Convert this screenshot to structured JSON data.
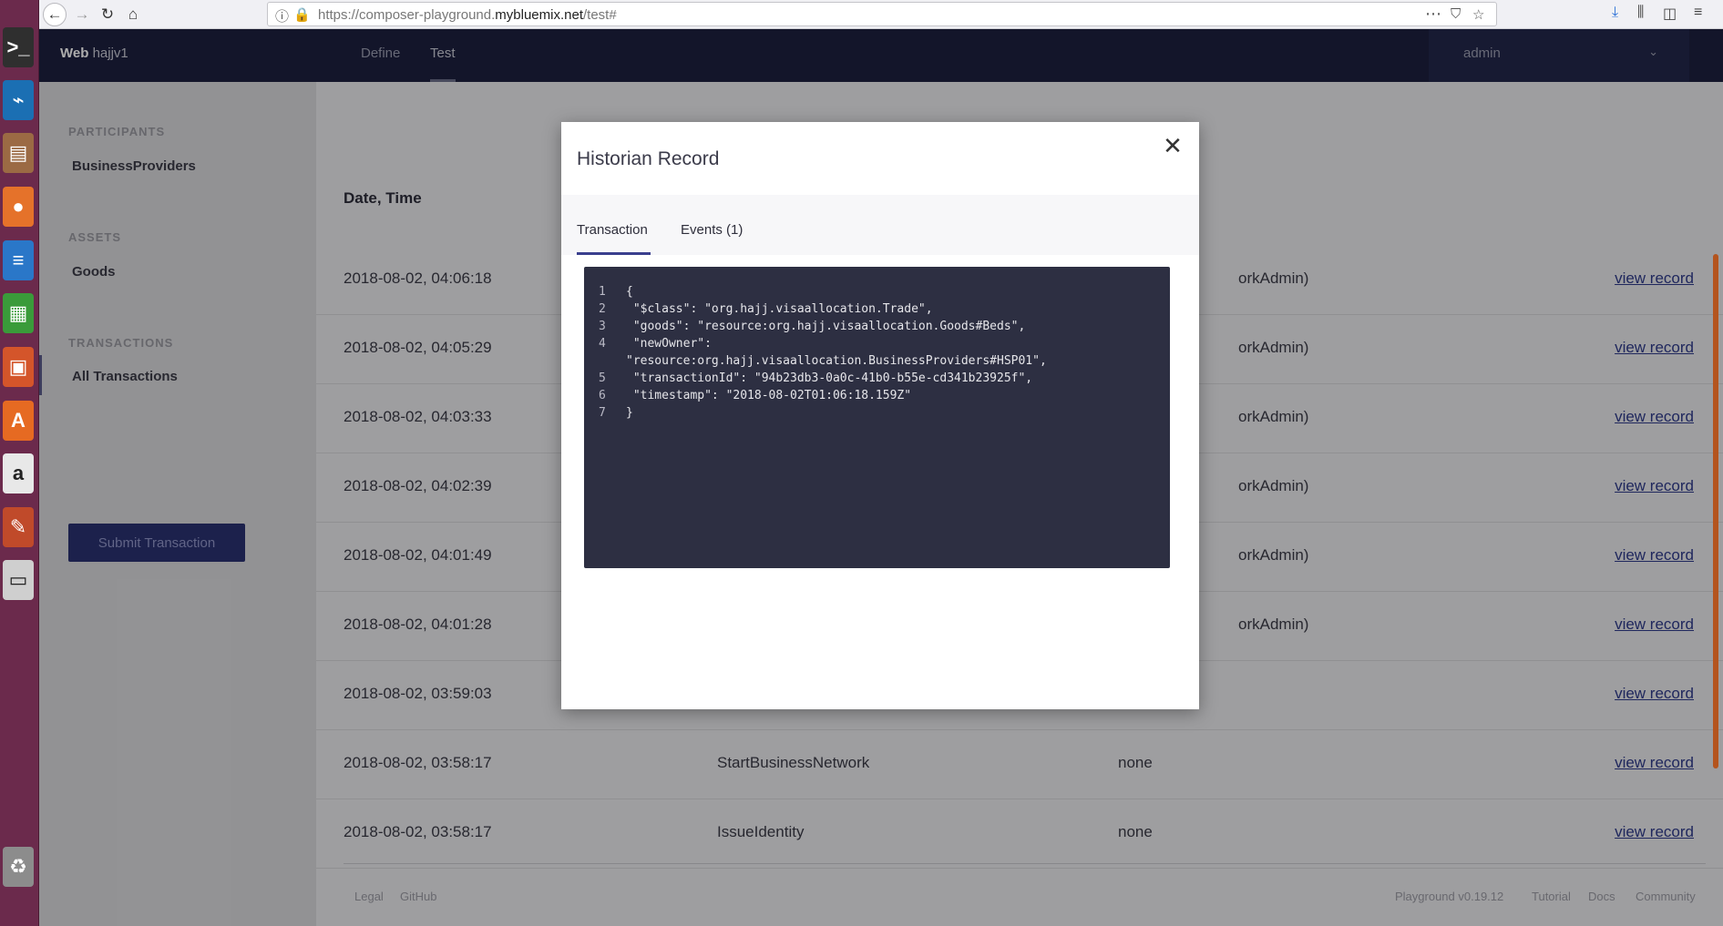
{
  "launcher": {
    "apps": [
      {
        "icon": "terminal-icon",
        "glyph": ">_",
        "bg": "#2f2f2f"
      },
      {
        "icon": "vscode-icon",
        "glyph": "⌁",
        "bg": "#1b6fb3"
      },
      {
        "icon": "files-icon",
        "glyph": "▤",
        "bg": "#9b6a44"
      },
      {
        "icon": "firefox-icon",
        "glyph": "●",
        "bg": "#e5722a"
      },
      {
        "icon": "writer-icon",
        "glyph": "≡",
        "bg": "#2a77c8"
      },
      {
        "icon": "calc-icon",
        "glyph": "▦",
        "bg": "#3a9b3a"
      },
      {
        "icon": "impress-icon",
        "glyph": "▣",
        "bg": "#d4552a"
      },
      {
        "icon": "software-center-icon",
        "glyph": "A",
        "bg": "#e66a22"
      },
      {
        "icon": "amazon-icon",
        "glyph": "a",
        "bg": "#e8e8e8"
      },
      {
        "icon": "settings-icon",
        "glyph": "✎",
        "bg": "#c04a2a"
      },
      {
        "icon": "drive-icon",
        "glyph": "▭",
        "bg": "#cfcfcf"
      },
      {
        "icon": "trash-icon",
        "glyph": "♻",
        "bg": "#8c8c8c"
      }
    ]
  },
  "browser": {
    "url_prefix": "https://composer-playground.",
    "url_domain": "mybluemix.net",
    "url_suffix": "/test#"
  },
  "topnav": {
    "brand_strong": "Web",
    "brand_name": "hajjv1",
    "tabs": [
      "Define",
      "Test"
    ],
    "user": "admin"
  },
  "sidebar": {
    "participants_heading": "PARTICIPANTS",
    "participant_item": "BusinessProviders",
    "assets_heading": "ASSETS",
    "asset_item": "Goods",
    "transactions_heading": "TRANSACTIONS",
    "transaction_item": "All Transactions",
    "submit_label": "Submit Transaction"
  },
  "table": {
    "col_date": "Date, Time",
    "view_label": "view record",
    "rows": [
      {
        "date": "2018-08-02, 04:06:18",
        "type": "",
        "participant": "orkAdmin)"
      },
      {
        "date": "2018-08-02, 04:05:29",
        "type": "",
        "participant": "orkAdmin)"
      },
      {
        "date": "2018-08-02, 04:03:33",
        "type": "",
        "participant": "orkAdmin)"
      },
      {
        "date": "2018-08-02, 04:02:39",
        "type": "",
        "participant": "orkAdmin)"
      },
      {
        "date": "2018-08-02, 04:01:49",
        "type": "",
        "participant": "orkAdmin)"
      },
      {
        "date": "2018-08-02, 04:01:28",
        "type": "",
        "participant": "orkAdmin)"
      },
      {
        "date": "2018-08-02, 03:59:03",
        "type": "",
        "participant": ""
      },
      {
        "date": "2018-08-02, 03:58:17",
        "type": "StartBusinessNetwork",
        "participant": "none"
      },
      {
        "date": "2018-08-02, 03:58:17",
        "type": "IssueIdentity",
        "participant": "none"
      }
    ]
  },
  "footer": {
    "legal": "Legal",
    "github": "GitHub",
    "version": "Playground v0.19.12",
    "tutorial": "Tutorial",
    "docs": "Docs",
    "community": "Community"
  },
  "modal": {
    "title": "Historian Record",
    "tab_transaction": "Transaction",
    "tab_events": "Events (1)",
    "code": [
      {
        "n": "1",
        "text": "{"
      },
      {
        "n": "2",
        "text": " \"$class\": \"org.hajj.visaallocation.Trade\","
      },
      {
        "n": "3",
        "text": " \"goods\": \"resource:org.hajj.visaallocation.Goods#Beds\","
      },
      {
        "n": "4",
        "text": " \"newOwner\":"
      },
      {
        "n": "",
        "text": "\"resource:org.hajj.visaallocation.BusinessProviders#HSP01\","
      },
      {
        "n": "5",
        "text": " \"transactionId\": \"94b23db3-0a0c-41b0-b55e-cd341b23925f\","
      },
      {
        "n": "6",
        "text": " \"timestamp\": \"2018-08-02T01:06:18.159Z\""
      },
      {
        "n": "7",
        "text": "}"
      }
    ]
  }
}
